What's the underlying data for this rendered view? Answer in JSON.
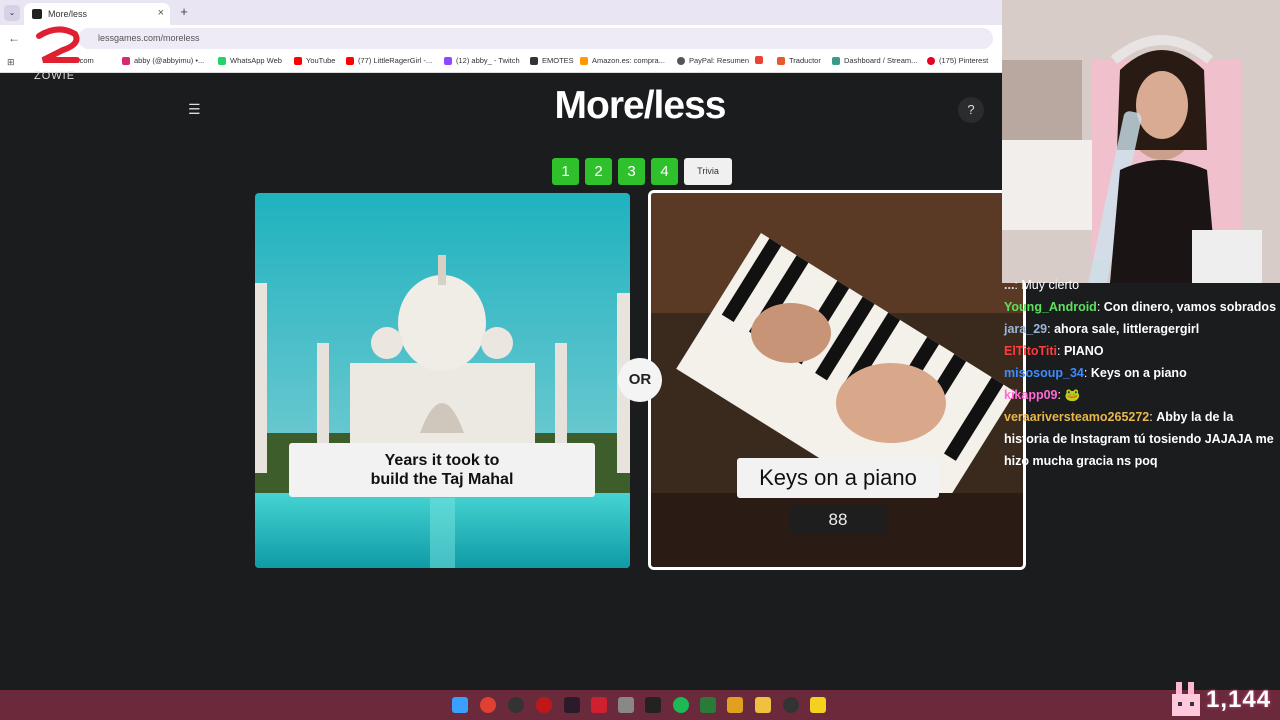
{
  "browser": {
    "tab_title": "More/less",
    "url": "lessgames.com/moreless",
    "bookmarks": [
      "witter.com",
      "abby (@abbyimu) •...",
      "WhatsApp Web",
      "YouTube",
      "(77) LittleRagerGirl -...",
      "(12) abby_ - Twitch",
      "EMOTES",
      "Amazon.es: compra...",
      "PayPal: Resumen",
      "Traductor",
      "Dashboard / Stream...",
      "(175) Pinterest"
    ]
  },
  "overlay": {
    "brand": "ZOWIE"
  },
  "game": {
    "title": "More/less",
    "help": "?",
    "levels": [
      "1",
      "2",
      "3",
      "4"
    ],
    "trivia_label": "Trivia",
    "left_card": {
      "line1": "Years it took to",
      "line2": "build the Taj Mahal"
    },
    "or_label": "OR",
    "right_card": {
      "label": "Keys on a piano",
      "value": "88"
    }
  },
  "chat": [
    {
      "user": "...",
      "color": "#ffffff",
      "text": "Muy cierto"
    },
    {
      "user": "Young_Android",
      "color": "#5ee05e",
      "text": "Con dinero, vamos sobrados"
    },
    {
      "user": "jara_29",
      "color": "#9bb5d6",
      "text": "ahora sale, littleragergirl"
    },
    {
      "user": "ElTitoTiti",
      "color": "#ff3b3b",
      "text": "PIANO"
    },
    {
      "user": "misosoup_34",
      "color": "#3d8cff",
      "text": "Keys on a piano"
    },
    {
      "user": "kikapp09",
      "color": "#ff69d4",
      "text": "🐸"
    },
    {
      "user": "veraariversteamo265272",
      "color": "#e8b64a",
      "text": "Abby la de la historia de Instagram tú tosiendo JAJAJA me hizo mucha gracia ns poq"
    }
  ],
  "viewer_count": "1,144",
  "colors": {
    "green": "#2fc12b",
    "taskbar": "#6b2a3c"
  }
}
